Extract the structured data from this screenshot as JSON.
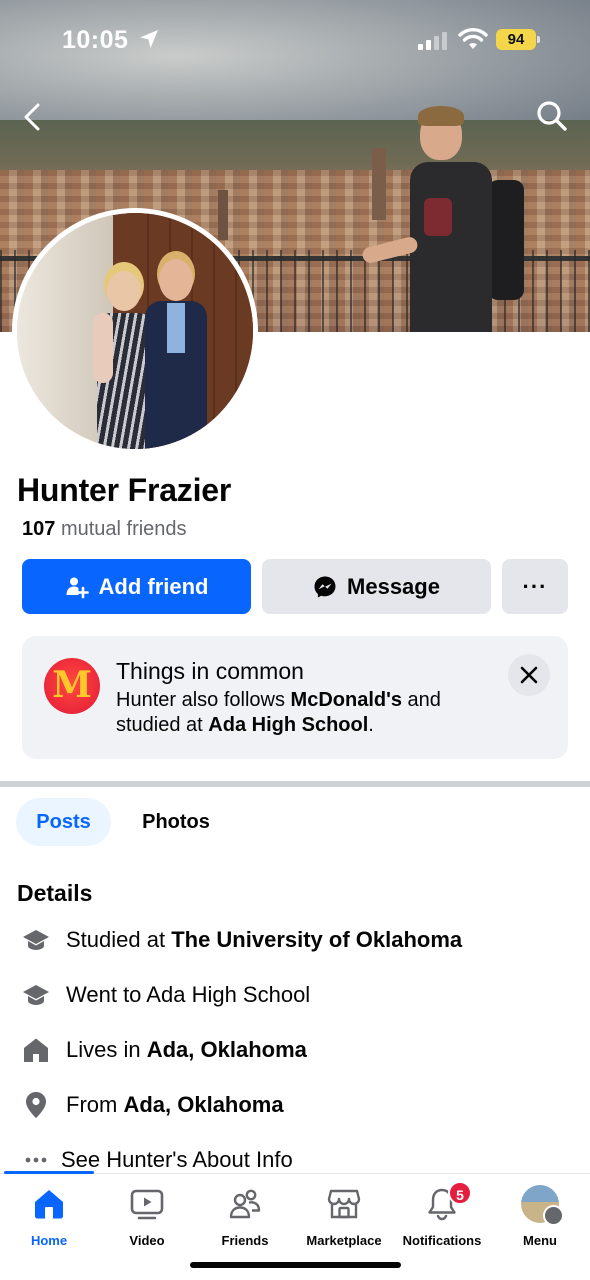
{
  "status": {
    "time": "10:05",
    "battery": "94"
  },
  "profile": {
    "name": "Hunter Frazier",
    "mutual_count": "107",
    "mutual_label": "mutual friends"
  },
  "actions": {
    "add_friend": "Add friend",
    "message": "Message",
    "more": "···"
  },
  "common": {
    "title": "Things in common",
    "line1_pre": "Hunter also follows ",
    "line1_bold": "McDonald's",
    "line1_post": " and",
    "line2_pre": "studied at ",
    "line2_bold": "Ada High School",
    "line2_post": "."
  },
  "tabs": {
    "posts": "Posts",
    "photos": "Photos"
  },
  "details": {
    "heading": "Details",
    "items": [
      {
        "icon": "graduation-cap-icon",
        "pre": "Studied at ",
        "bold": "The University of Oklahoma"
      },
      {
        "icon": "graduation-cap-icon",
        "pre": "Went to Ada High School",
        "bold": ""
      },
      {
        "icon": "house-icon",
        "pre": "Lives in ",
        "bold": "Ada, Oklahoma"
      },
      {
        "icon": "location-pin-icon",
        "pre": "From ",
        "bold": "Ada, Oklahoma"
      },
      {
        "icon": "more-dots-icon",
        "pre": "See Hunter's About Info",
        "bold": ""
      }
    ]
  },
  "nav": {
    "items": [
      {
        "label": "Home",
        "icon": "home-icon"
      },
      {
        "label": "Video",
        "icon": "video-icon"
      },
      {
        "label": "Friends",
        "icon": "friends-icon"
      },
      {
        "label": "Marketplace",
        "icon": "marketplace-icon"
      },
      {
        "label": "Notifications",
        "icon": "bell-icon",
        "badge": "5"
      },
      {
        "label": "Menu",
        "icon": "menu-avatar"
      }
    ]
  },
  "colors": {
    "accent": "#0866ff",
    "badge": "#e41e3f",
    "muted": "#65676b"
  }
}
